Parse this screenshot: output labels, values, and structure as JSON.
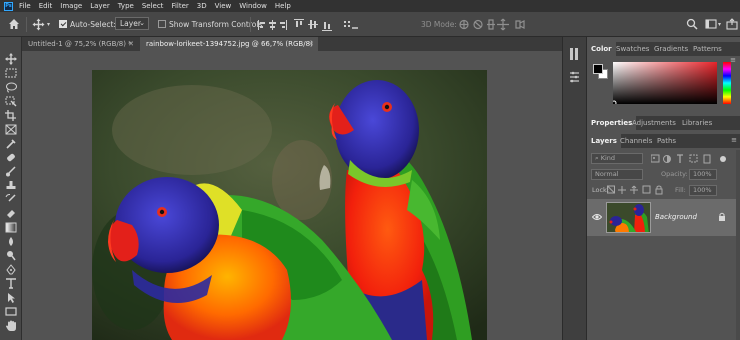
{
  "app": {
    "logo": "Ps"
  },
  "menu": [
    "File",
    "Edit",
    "Image",
    "Layer",
    "Type",
    "Select",
    "Filter",
    "3D",
    "View",
    "Window",
    "Help"
  ],
  "options_bar": {
    "auto_select_label": "Auto-Select:",
    "auto_select_checked": true,
    "auto_select_target": "Layer",
    "show_transform_label": "Show Transform Controls",
    "show_transform_checked": false,
    "mode_3d_label": "3D Mode:"
  },
  "tabs": [
    {
      "label": "Untitled-1 @ 75,2% (RGB/8) *",
      "active": false
    },
    {
      "label": "rainbow-lorikeet-1394752.jpg @ 66,7% (RGB/8)",
      "active": true
    }
  ],
  "color_panel": {
    "tabs": [
      "Color",
      "Swatches",
      "Gradients",
      "Patterns"
    ],
    "active_tab": "Color",
    "foreground": "#000000",
    "background": "#ffffff",
    "hue": "#e8242a"
  },
  "properties_panel": {
    "tabs": [
      "Properties",
      "Adjustments",
      "Libraries"
    ],
    "active_tab": "Properties"
  },
  "layers_panel": {
    "tabs": [
      "Layers",
      "Channels",
      "Paths"
    ],
    "active_tab": "Layers",
    "kind_filter": "Kind",
    "blend_mode": "Normal",
    "opacity_label": "Opacity:",
    "opacity_value": "100%",
    "lock_label": "Lock:",
    "fill_label": "Fill:",
    "fill_value": "100%",
    "layers": [
      {
        "name": "Background",
        "visible": true,
        "locked": true
      }
    ]
  },
  "icons": {
    "home": "home-icon",
    "move": "move-icon",
    "search": "search-icon",
    "workspace": "workspace-icon",
    "share": "share-icon"
  }
}
